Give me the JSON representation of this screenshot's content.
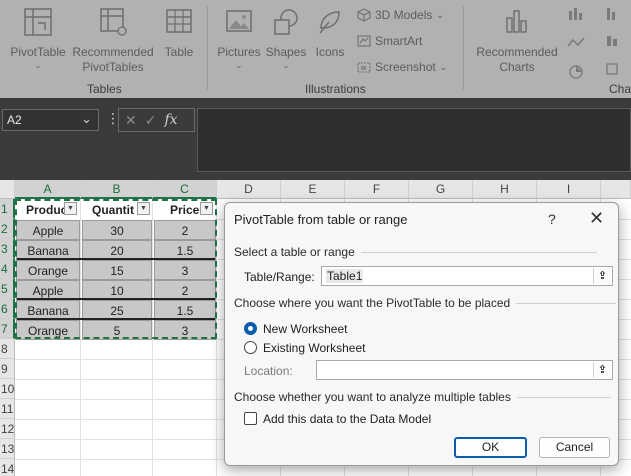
{
  "ribbon": {
    "tables_group": {
      "label": "Tables",
      "pivot_table": "PivotTable",
      "recommended_line1": "Recommended",
      "recommended_line2": "PivotTables",
      "table": "Table"
    },
    "illustrations_group": {
      "label": "Illustrations",
      "pictures": "Pictures",
      "shapes": "Shapes",
      "icons": "Icons",
      "models_3d": "3D Models",
      "smartart": "SmartArt",
      "screenshot": "Screenshot"
    },
    "charts_group": {
      "label": "Char",
      "recommended_line1": "Recommended",
      "recommended_line2": "Charts"
    }
  },
  "formula_bar": {
    "name_box": "A2",
    "fx": "fx",
    "content": ""
  },
  "sheet": {
    "columns": [
      "A",
      "B",
      "C",
      "D",
      "E",
      "F",
      "G",
      "H",
      "I"
    ],
    "selected_columns": [
      "A",
      "B",
      "C"
    ],
    "rows": [
      "1",
      "2",
      "3",
      "4",
      "5",
      "6",
      "7",
      "8",
      "9",
      "10",
      "11",
      "12",
      "13",
      "14"
    ],
    "header": [
      "Produc",
      "Quantit",
      "Price"
    ],
    "data": [
      [
        "Apple",
        "30",
        "2"
      ],
      [
        "Banana",
        "20",
        "1.5"
      ],
      [
        "Orange",
        "15",
        "3"
      ],
      [
        "Apple",
        "10",
        "2"
      ],
      [
        "Banana",
        "25",
        "1.5"
      ],
      [
        "Orange",
        "5",
        "3"
      ]
    ]
  },
  "dialog": {
    "title": "PivotTable from table or range",
    "help": "?",
    "close": "✕",
    "section_select": "Select a table or range",
    "table_range_label": "Table/Range:",
    "table_range_value": "Table1",
    "section_place": "Choose where you want the PivotTable to be placed",
    "new_worksheet": "New Worksheet",
    "existing_worksheet": "Existing Worksheet",
    "location_label": "Location:",
    "location_value": "",
    "section_multi": "Choose whether you want to analyze multiple tables",
    "data_model_label": "Add this data to the Data Model",
    "ok": "OK",
    "cancel": "Cancel",
    "selected_option": "New Worksheet",
    "data_model_checked": false
  },
  "colors": {
    "accent_green": "#217346",
    "primary_blue": "#0b5cad"
  }
}
